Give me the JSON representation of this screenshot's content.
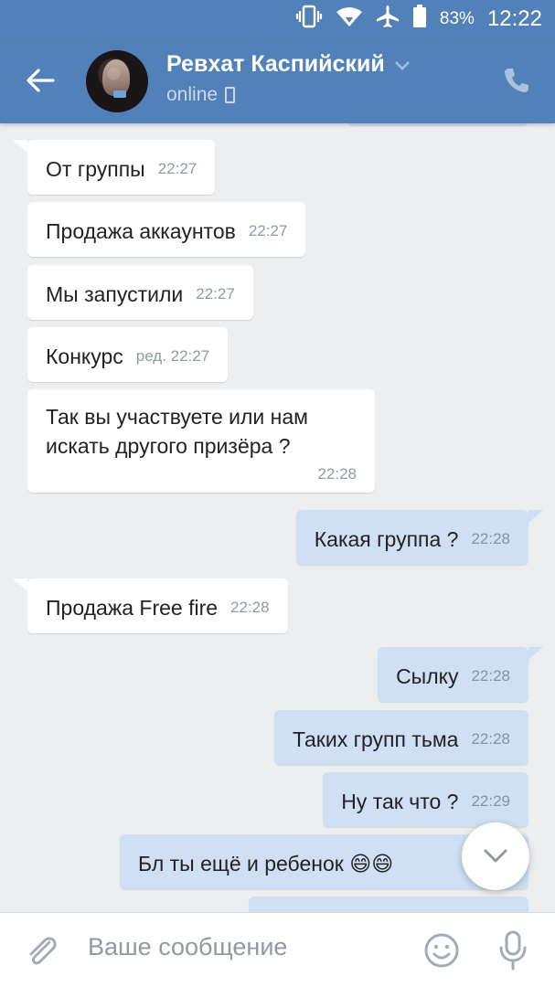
{
  "status_bar": {
    "battery_percent": "83%",
    "time": "12:22",
    "icons": [
      "vibrate-icon",
      "wifi-icon",
      "airplane-icon",
      "battery-icon"
    ]
  },
  "header": {
    "contact_name": "Ревхат Каспийский",
    "status": "online",
    "icons": [
      "back-arrow-icon",
      "chevron-down-icon",
      "mobile-icon",
      "phone-icon"
    ]
  },
  "messages": [
    {
      "direction": "in",
      "text": "От группы",
      "time": "22:27"
    },
    {
      "direction": "in",
      "text": "Продажа аккаунтов",
      "time": "22:27"
    },
    {
      "direction": "in",
      "text": "Мы запустили",
      "time": "22:27"
    },
    {
      "direction": "in",
      "text": "Конкурс",
      "time": "ред. 22:27"
    },
    {
      "direction": "in",
      "text_line1": "Так вы участвуете или нам",
      "text_line2": "искать другого призёра ?",
      "time": "22:28"
    },
    {
      "direction": "out",
      "text": "Какая группа ?",
      "time": "22:28"
    },
    {
      "direction": "in",
      "text": "Продажа Free fire",
      "time": "22:28"
    },
    {
      "direction": "out",
      "text": "Сылку",
      "time": "22:28"
    },
    {
      "direction": "out",
      "text": "Таких групп тьма",
      "time": "22:28"
    },
    {
      "direction": "out",
      "text": "Ну так что ?",
      "time": "22:29"
    },
    {
      "direction": "out",
      "text": "Бл ты ещё и ребенок 😄😄",
      "time": ""
    }
  ],
  "composer": {
    "placeholder": "Ваше сообщение",
    "icons": [
      "paperclip-icon",
      "emoji-icon",
      "microphone-icon"
    ]
  },
  "colors": {
    "header": "#5181b8",
    "background": "#edeef0",
    "incoming_bubble": "#ffffff",
    "outgoing_bubble": "#cfe0f4"
  }
}
